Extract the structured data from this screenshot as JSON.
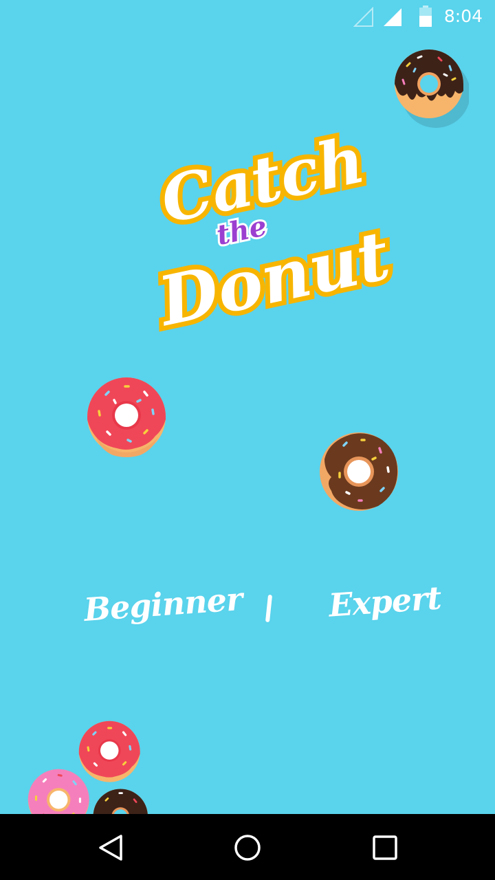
{
  "status_bar": {
    "time": "8:04",
    "icons": [
      "signal-empty-icon",
      "signal-full-icon",
      "battery-icon"
    ],
    "icon_color": "#ffffff"
  },
  "logo": {
    "line1": "Catch",
    "line2": "the",
    "line3": "Donut",
    "fill_color": "#ffffff",
    "outline_color": "#f7b500",
    "accent_color": "#9b3fd0"
  },
  "menu": {
    "beginner_label": "Beginner",
    "divider": "|",
    "expert_label": "Expert"
  },
  "donuts": [
    {
      "name": "donut-chocolate-dripping",
      "icing": "#3d2218"
    },
    {
      "name": "donut-strawberry",
      "icing": "#f04758"
    },
    {
      "name": "donut-chocolate",
      "icing": "#6b3a1e"
    },
    {
      "name": "donut-strawberry",
      "icing": "#f04758"
    },
    {
      "name": "donut-pink",
      "icing": "#f57fbc"
    },
    {
      "name": "donut-chocolate",
      "icing": "#3d2218"
    }
  ],
  "nav_bar": {
    "icons": [
      "back-icon",
      "home-icon",
      "recents-icon"
    ]
  },
  "colors": {
    "background": "#5ad3ec",
    "dough": "#f7b56b",
    "nav_background": "#000000"
  }
}
